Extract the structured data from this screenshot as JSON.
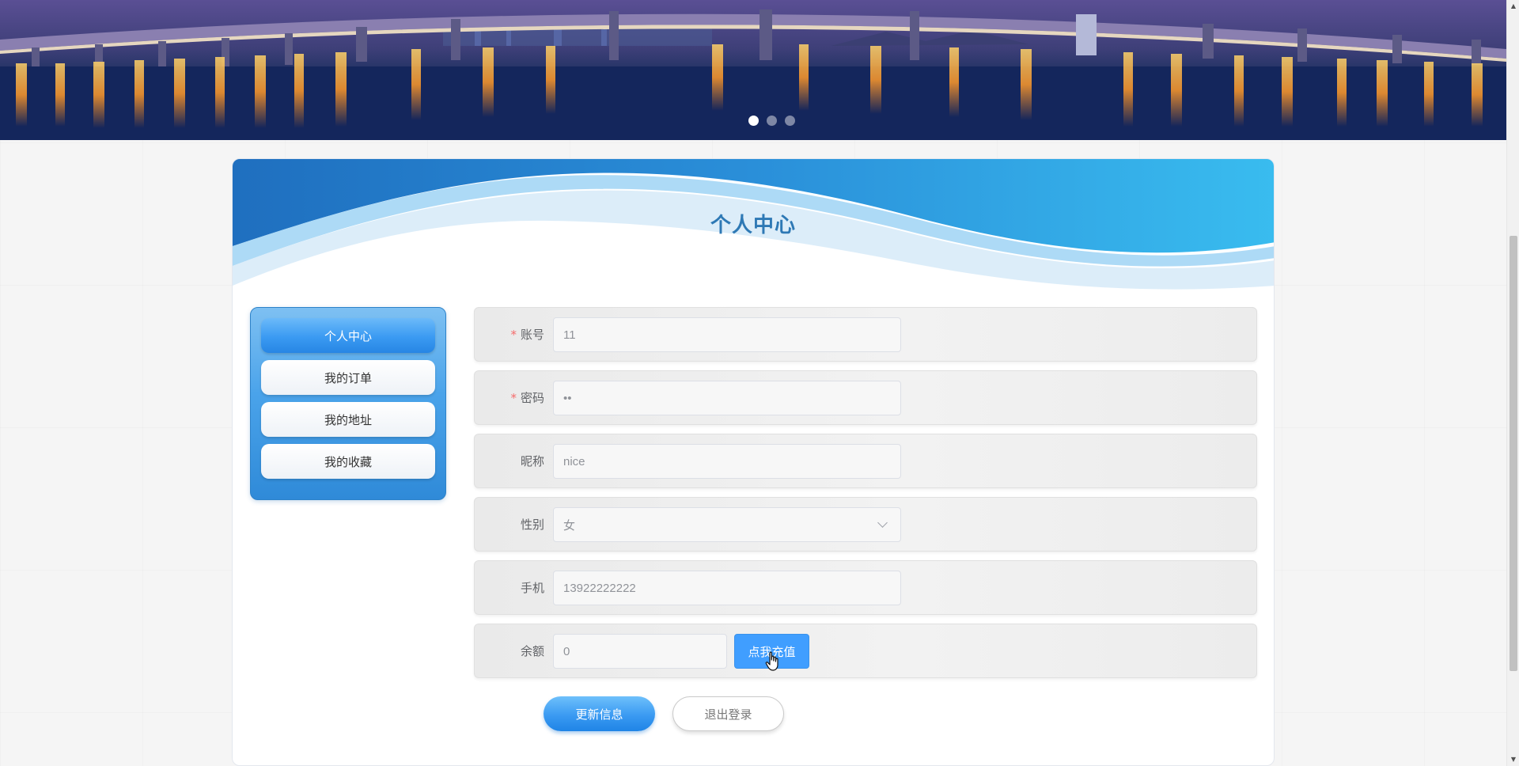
{
  "banner": {
    "slides": 3,
    "active_slide": 1
  },
  "page": {
    "title": "个人中心"
  },
  "side_menu": {
    "items": [
      {
        "label": "个人中心",
        "active": true
      },
      {
        "label": "我的订单",
        "active": false
      },
      {
        "label": "我的地址",
        "active": false
      },
      {
        "label": "我的收藏",
        "active": false
      }
    ]
  },
  "form": {
    "account": {
      "label": "账号",
      "required": true,
      "value": "11"
    },
    "password": {
      "label": "密码",
      "required": true,
      "value": "••"
    },
    "nickname": {
      "label": "昵称",
      "required": false,
      "value": "nice"
    },
    "gender": {
      "label": "性别",
      "required": false,
      "value": "女"
    },
    "phone": {
      "label": "手机",
      "required": false,
      "value": "13922222222"
    },
    "balance": {
      "label": "余额",
      "required": false,
      "value": "0",
      "recharge_label": "点我充值"
    }
  },
  "actions": {
    "update_label": "更新信息",
    "logout_label": "退出登录"
  },
  "colors": {
    "accent": "#409eff",
    "title": "#2e79b5",
    "required": "#f56c6c"
  }
}
